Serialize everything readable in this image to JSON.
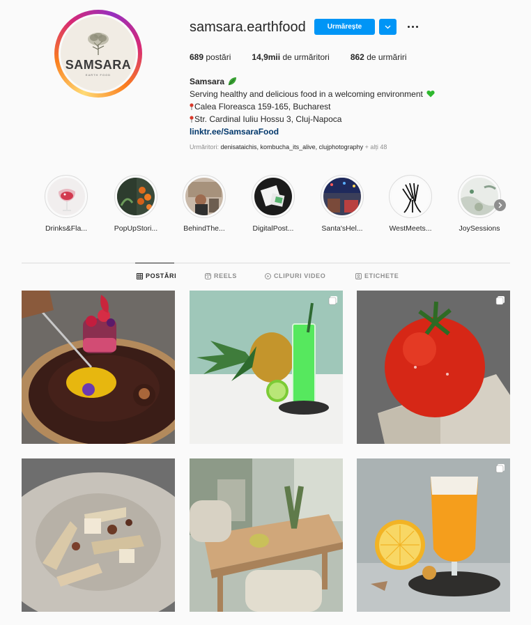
{
  "profile": {
    "username": "samsara.earthfood",
    "avatar_brand": "SAMSARA",
    "avatar_brand_sub": "EARTH FOOD",
    "follow_label": "Urmărește",
    "stats": [
      {
        "value": "689",
        "label": "postări"
      },
      {
        "value": "14,9mii",
        "label": "de urmăritori"
      },
      {
        "value": "862",
        "label": "de urmăriri"
      }
    ],
    "bio": {
      "name": "Samsara",
      "line1": "Serving healthy and delicious food in a welcoming environment",
      "line2": "Calea Floreasca 159-165, Bucharest",
      "line3": "Str. Cardinal Iuliu Hossu 3, Cluj-Napoca",
      "link": "linktr.ee/SamsaraFood"
    },
    "followed_by": {
      "prefix": "Urmăritori:",
      "names": "denisataichis, kombucha_its_alive, clujphotography",
      "suffix": "+ alți 48"
    }
  },
  "highlights": [
    {
      "label": "Drinks&Fla..."
    },
    {
      "label": "PopUpStori..."
    },
    {
      "label": "BehindThe..."
    },
    {
      "label": "DigitalPost..."
    },
    {
      "label": "Santa'sHel..."
    },
    {
      "label": "WestMeets..."
    },
    {
      "label": "JoySessions"
    }
  ],
  "tabs": [
    {
      "label": "POSTĂRI",
      "icon": "grid-icon",
      "active": true
    },
    {
      "label": "REELS",
      "icon": "reels-icon"
    },
    {
      "label": "CLIPURI VIDEO",
      "icon": "video-icon"
    },
    {
      "label": "ETICHETE",
      "icon": "tagged-icon"
    }
  ],
  "posts": [
    {
      "subject": "dessert-plate",
      "multi": false
    },
    {
      "subject": "pineapple-drink",
      "multi": true
    },
    {
      "subject": "tomato",
      "multi": true
    },
    {
      "subject": "pasta-bowl",
      "multi": false
    },
    {
      "subject": "restaurant-table",
      "multi": false
    },
    {
      "subject": "orange-drink",
      "multi": true
    }
  ],
  "colors": {
    "accent": "#0095f6",
    "link": "#00376b",
    "text": "#262626",
    "muted": "#8e8e8e"
  }
}
